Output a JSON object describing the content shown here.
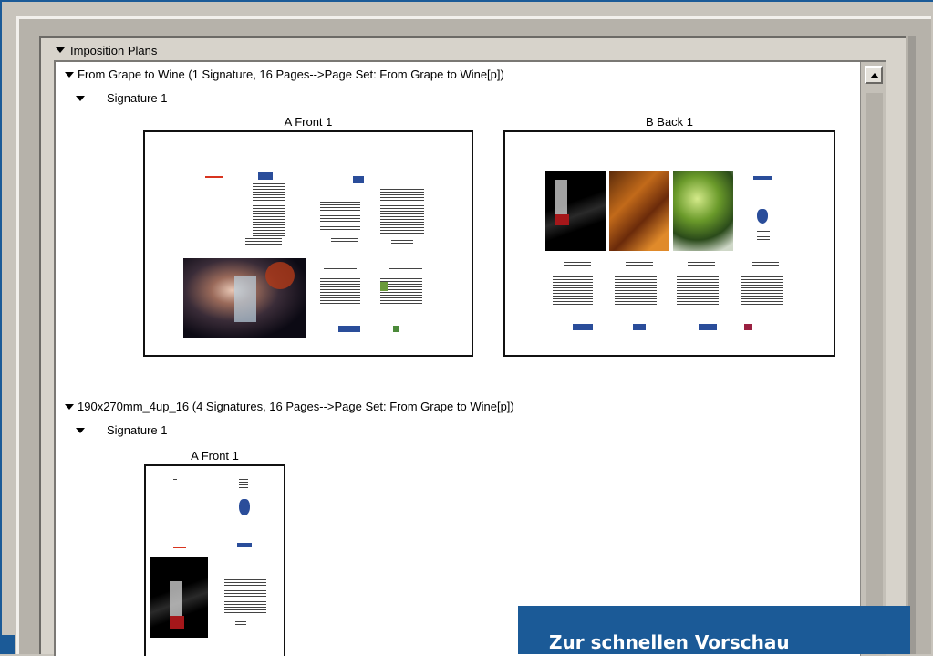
{
  "window": {
    "title": "Imposition Plans"
  },
  "plans": [
    {
      "title": "From Grape to Wine (1 Signature, 16 Pages-->Page Set: From Grape to Wine[p])",
      "signature": "Signature 1",
      "sheets": [
        "A Front 1",
        "B Back 1"
      ]
    },
    {
      "title": "190x270mm_4up_16 (4 Signatures, 16 Pages-->Page Set: From Grape to Wine[p])",
      "signature": "Signature 1",
      "sheets": [
        "A Front 1"
      ]
    }
  ],
  "caption": "Zur schnellen Vorschau",
  "colors": {
    "accent": "#1b5a97",
    "window_bg": "#d7d3cb",
    "panel_bg": "#ffffff"
  },
  "icons": {
    "expand": "triangle-down-icon",
    "scroll_up": "arrow-up-icon"
  }
}
